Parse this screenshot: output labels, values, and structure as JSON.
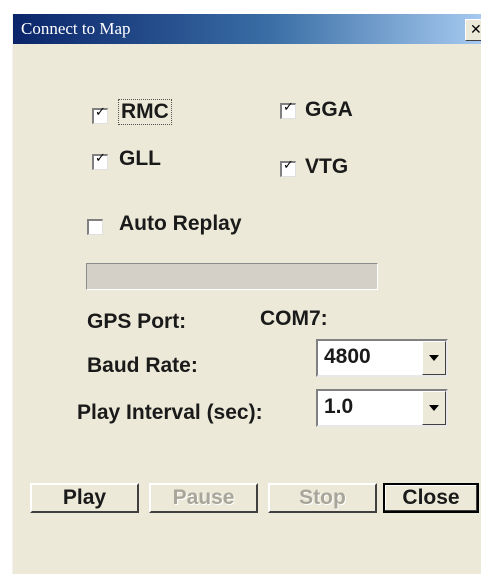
{
  "window": {
    "title": "Connect to Map",
    "close_glyph": "✕"
  },
  "sentences": {
    "rmc": {
      "label": "RMC",
      "checked": true
    },
    "gga": {
      "label": "GGA",
      "checked": true
    },
    "gll": {
      "label": "GLL",
      "checked": true
    },
    "vtg": {
      "label": "VTG",
      "checked": true
    }
  },
  "auto_replay": {
    "label": "Auto Replay",
    "checked": false
  },
  "progress": {
    "value": 0
  },
  "gps_port": {
    "label": "GPS Port:",
    "value": "COM7:"
  },
  "baud_rate": {
    "label": "Baud Rate:",
    "value": "4800"
  },
  "play_interval": {
    "label": "Play Interval (sec):",
    "value": "1.0"
  },
  "buttons": {
    "play": "Play",
    "pause": "Pause",
    "stop": "Stop",
    "close": "Close"
  },
  "check_glyph": "✓",
  "colors": {
    "title_start": "#0a246a",
    "title_end": "#a6caf0",
    "face": "#ece9d8"
  }
}
